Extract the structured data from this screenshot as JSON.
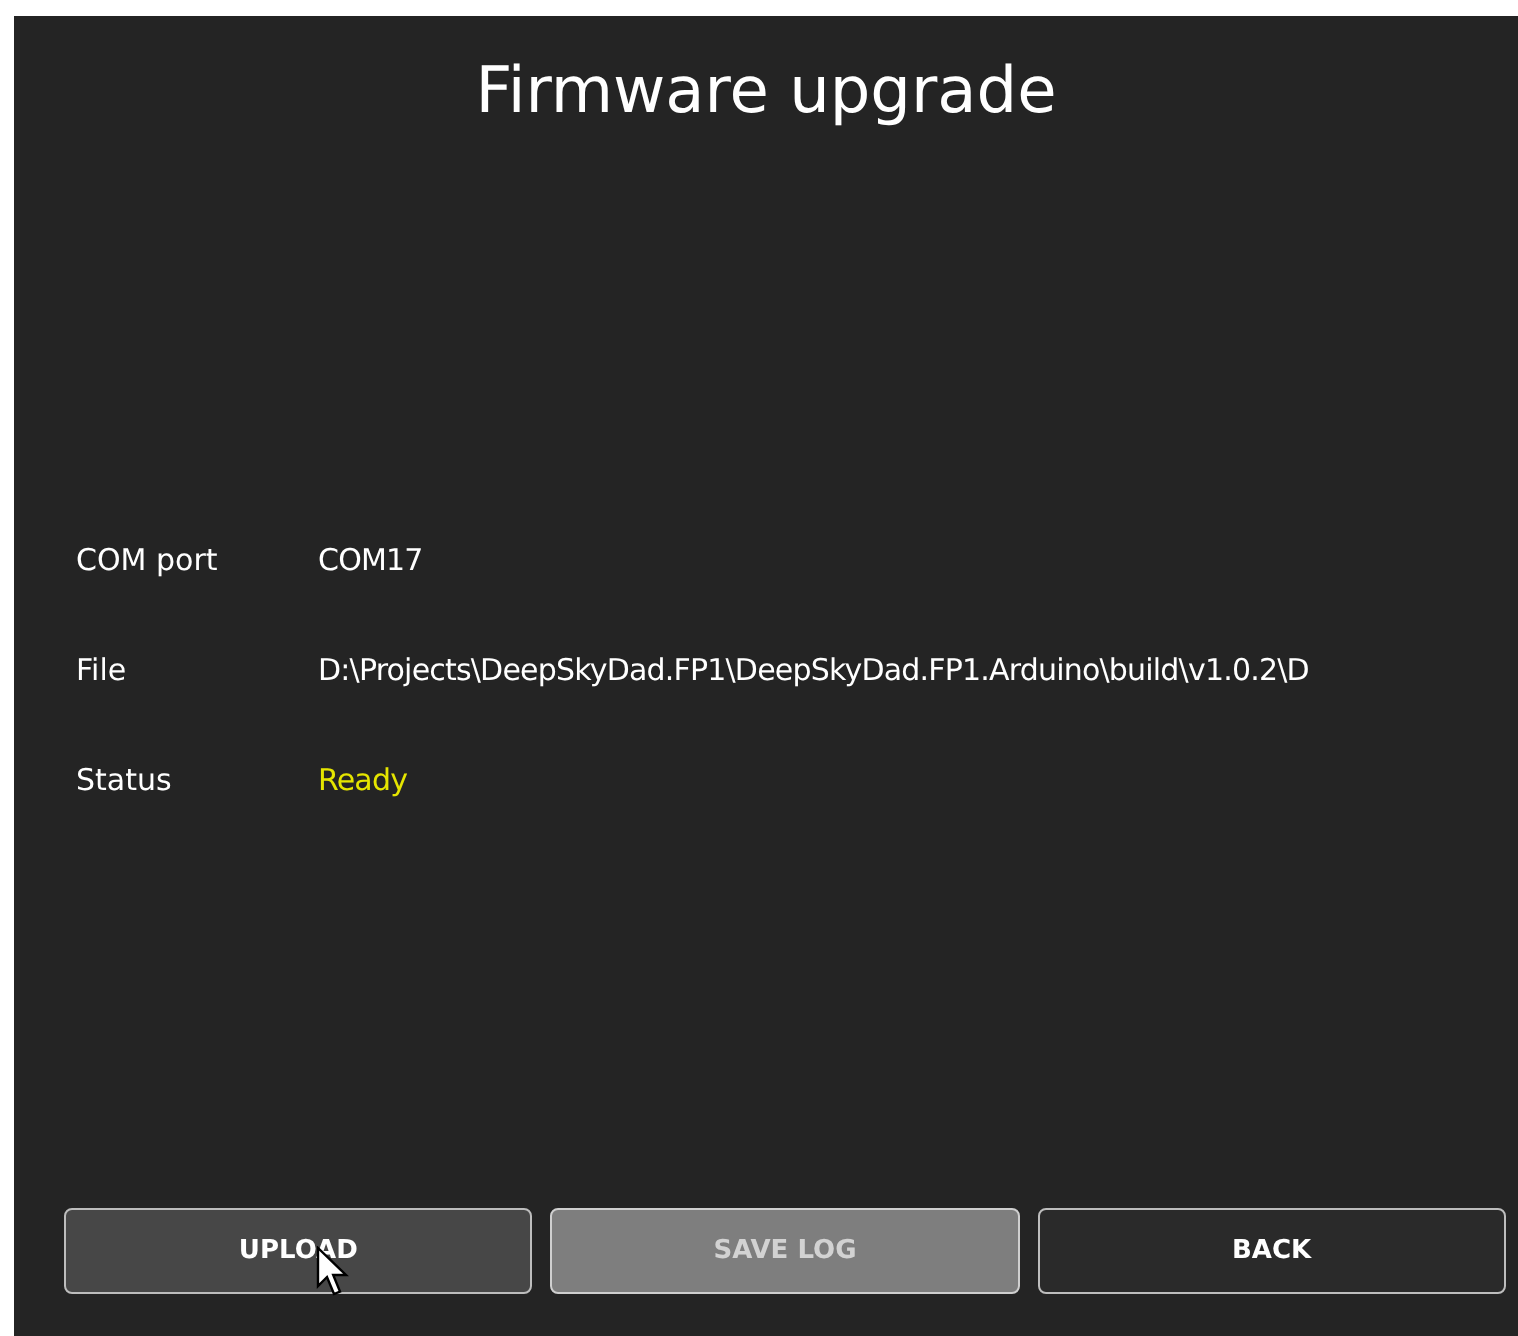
{
  "title": "Firmware upgrade",
  "fields": [
    {
      "label": "COM port",
      "value": "COM17",
      "kind": "plain"
    },
    {
      "label": "File",
      "value": "D:\\Projects\\DeepSkyDad.FP1\\DeepSkyDad.FP1.Arduino\\build\\v1.0.2\\D",
      "kind": "plain"
    },
    {
      "label": "Status",
      "value": "Ready",
      "kind": "status"
    }
  ],
  "buttons": [
    {
      "label": "UPLOAD",
      "hovered": true,
      "disabled": false
    },
    {
      "label": "SAVE LOG",
      "hovered": false,
      "disabled": true
    },
    {
      "label": "BACK",
      "hovered": false,
      "disabled": false
    }
  ]
}
